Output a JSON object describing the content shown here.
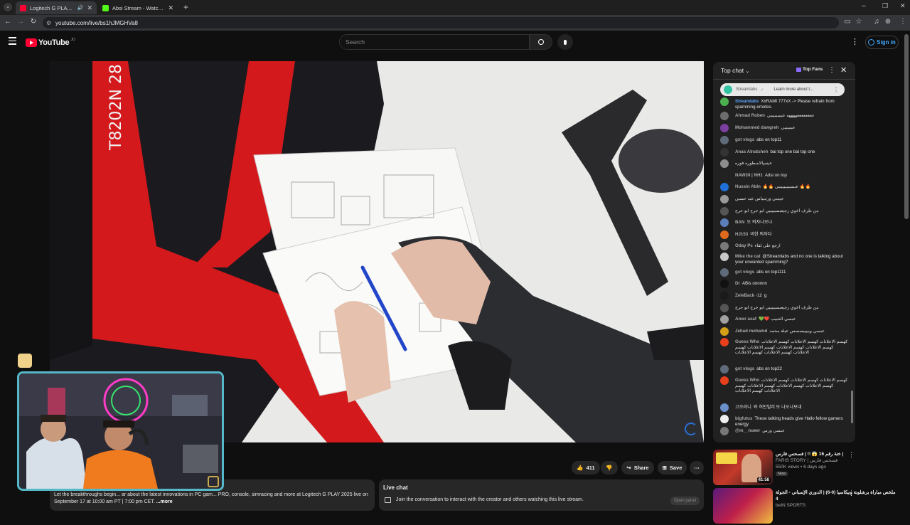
{
  "browser": {
    "tabs": [
      {
        "title": "Logitech G PLAY 2025 - You",
        "favicon_color": "#ff0033",
        "active": true
      },
      {
        "title": "Absi Stream - Watch Live on K",
        "favicon_color": "#53fc18",
        "active": false
      }
    ],
    "url": "youtube.com/live/bs1hJMGHVa8"
  },
  "youtube": {
    "logo_text": "YouTube",
    "logo_sup": "JO",
    "search_placeholder": "Search",
    "signin_label": "Sign in"
  },
  "chat": {
    "mode_label": "Top chat",
    "top_fans_label": "Top Fans",
    "pinned": {
      "author": "Streamlabs",
      "cta": "Learn more about t..."
    },
    "messages": [
      {
        "author": "Streamlabs",
        "text": "XxRAMI 777xX -> Please refrain from spamming emotes.",
        "color": "#4caf50",
        "highlight": true
      },
      {
        "author": "Ahmad Roben",
        "text": "ععععععععههههه عببببببيييي",
        "color": "#6d6d6d"
      },
      {
        "author": "Mohammed dawgreh",
        "text": "عبببببيي",
        "color": "#7b3fa0"
      },
      {
        "author": "gxt vlogs",
        "text": "abs on top11",
        "color": "#5f6b7a"
      },
      {
        "author": "Anas Alnatsheh",
        "text": "bai top one bai top one",
        "color": "#333333"
      },
      {
        "author": "عبسي",
        "text": "الاسطوره فوزه",
        "color": "#8d8d8d"
      },
      {
        "author": "NAW39 | NH1",
        "text": "Adsi on top",
        "color": "#222222"
      },
      {
        "author": "Hussin Abln",
        "text": "🔥🔥 عبسيييييييييي 🔥🔥",
        "color": "#1e6fd8"
      },
      {
        "author": "عبسي ورس",
        "text": "ياس عبد حسين",
        "color": "#9a9a9a"
      },
      {
        "author": "من طرف اخوي رجب",
        "text": "عبسيييييي ابو جرج ابو جرج",
        "color": "#555555"
      },
      {
        "author": "BAN",
        "text": "오 의자나오나",
        "color": "#5b7db8"
      },
      {
        "author": "HJ153",
        "text": "비한 의자다",
        "color": "#e06a1b"
      },
      {
        "author": "Oday Pc",
        "text": "ارجع على لقاء",
        "color": "#7a7a7a"
      },
      {
        "author": "Mike the cat",
        "text": "@Streamlabs and no one is talking about your unwanted spamming?",
        "color": "#c9c9c9"
      },
      {
        "author": "gxt vlogs",
        "text": "abs on top1111",
        "color": "#5f6b7a"
      },
      {
        "author": "Dr",
        "text": "ABis onnnnn",
        "color": "#111111"
      },
      {
        "author": "ZeleBack -12",
        "text": "g",
        "color": "#1a1a1a"
      },
      {
        "author": "من طرف اخوي رجب",
        "text": "عبسيييييي ابو جرج ابو جرج",
        "color": "#555555"
      },
      {
        "author": "Amer asaf",
        "text": "💚❤️ عبسي الحبيب",
        "color": "#a0a0a0"
      },
      {
        "author": "Jehad mohamd",
        "text": "عبسي ويييييسسس عيلة محمد",
        "color": "#d4a017"
      },
      {
        "author": "Guess Who",
        "text": "كهسم الاعلانات كهسم الاعلانات كهسم الاعلانات كهسم الاعلانات كهسم الاعلانات كهسم الاعلانات كهسم الاعلانات كهسم الاعلانات كهسم الاعلانات",
        "color": "#e8401c"
      },
      {
        "author": "gxt vlogs",
        "text": "abs on top22",
        "color": "#5f6b7a"
      },
      {
        "author": "Guess Who",
        "text": "كهسم الاعلانات كهسم الاعلانات كهسم الاعلانات كهسم الاعلانات كهسم الاعلانات كهسم الاعلانات كهسم الاعلانات كهسم الاعلانات",
        "color": "#e8401c"
      },
      {
        "author": "고조라니",
        "text": "와 허만밀러 또 나오나보네",
        "color": "#6a8fc9"
      },
      {
        "author": "bigfutus",
        "text": "These talking heads give Hallo fellow gamers energy",
        "color": "#eeeeee"
      },
      {
        "author": "@m__nueer",
        "text": "عبسي ورس",
        "color": "#777777"
      }
    ]
  },
  "actions": {
    "likes": "411",
    "share_label": "Share",
    "save_label": "Save"
  },
  "description": {
    "text": "Let the breakthroughs begin... ar about the latest innovations in PC gam... PRO, console, simracing and more at Logitech G PLAY 2025 live on September 17 at 10:00 am PT | 7:00 pm CET.",
    "more_label": "...more"
  },
  "livechat_panel": {
    "title": "Live chat",
    "subtitle": "Join the conversation to interact with the creator and others watching this live stream.",
    "open_label": "Open panel"
  },
  "recommendations": [
    {
      "title": "ختة رقم 16 😱 !! | فسحس فارس |",
      "channel": "FARIS STORY | فسحس فارس",
      "stats": "550K views • 6 days ago",
      "badge": "New",
      "duration": "41:58"
    },
    {
      "title": "ملخص مباراة برشلونة ونيكاسيا (0-6) | الدوري الإسباني - الجولة 4",
      "channel": "beIN SPORTS",
      "stats": "",
      "badge": "",
      "duration": ""
    }
  ]
}
